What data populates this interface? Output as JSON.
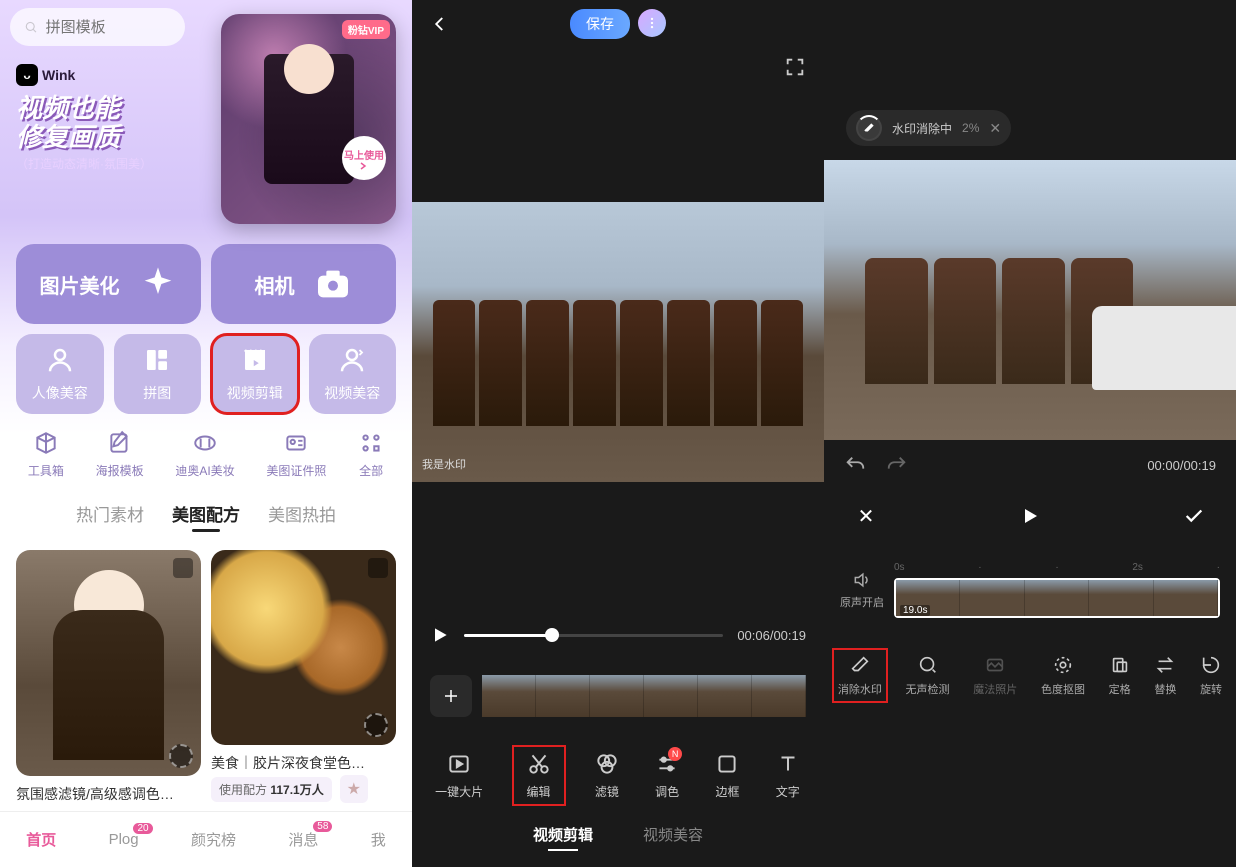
{
  "left": {
    "search_placeholder": "拼图模板",
    "wink_brand": "Wink",
    "promo_title_1": "视频也能",
    "promo_title_2": "修复画质",
    "promo_sub": "（打造动态清晰·氛围美）",
    "vip_badge": "粉钻VIP",
    "use_now": "马上使用",
    "big_buttons": {
      "beautify": "图片美化",
      "camera": "相机"
    },
    "tools": {
      "portrait": "人像美容",
      "collage": "拼图",
      "video_edit": "视频剪辑",
      "video_beauty": "视频美容"
    },
    "small": {
      "toolbox": "工具箱",
      "poster": "海报模板",
      "dior": "迪奥AI美妆",
      "id_photo": "美图证件照",
      "all": "全部"
    },
    "tabs": {
      "hot_material": "热门素材",
      "recipe": "美图配方",
      "hot_shoot": "美图热拍"
    },
    "feed": [
      {
        "title": "氛围感滤镜/高级感调色…"
      },
      {
        "title": "美食｜胶片深夜食堂色…",
        "use_label": "使用配方",
        "use_count": "117.1万人"
      }
    ],
    "bottom": {
      "home": "首页",
      "plog": "Plog",
      "plog_badge": "20",
      "rank": "颜究榜",
      "msg": "消息",
      "msg_badge": "58",
      "me": "我"
    }
  },
  "mid": {
    "save": "保存",
    "watermark_text": "我是水印",
    "time": "00:06/00:19",
    "tools": {
      "oneclick": "一键大片",
      "edit": "编辑",
      "filter": "滤镜",
      "color": "调色",
      "border": "边框",
      "text": "文字",
      "color_badge": "N"
    },
    "subtabs": {
      "video_edit": "视频剪辑",
      "video_beauty": "视频美容"
    }
  },
  "right": {
    "wm_removing": "水印消除中",
    "wm_pct": "2%",
    "time": "00:00/00:19",
    "sound_on": "原声开启",
    "ruler": {
      "t0": "0s",
      "t2": "2s"
    },
    "clip_stamp": "19.0s",
    "tools": {
      "remove_wm": "消除水印",
      "silent_detect": "无声检测",
      "magic_photo": "魔法照片",
      "chroma": "色度抠图",
      "freeze": "定格",
      "replace": "替换",
      "rotate": "旋转"
    }
  }
}
